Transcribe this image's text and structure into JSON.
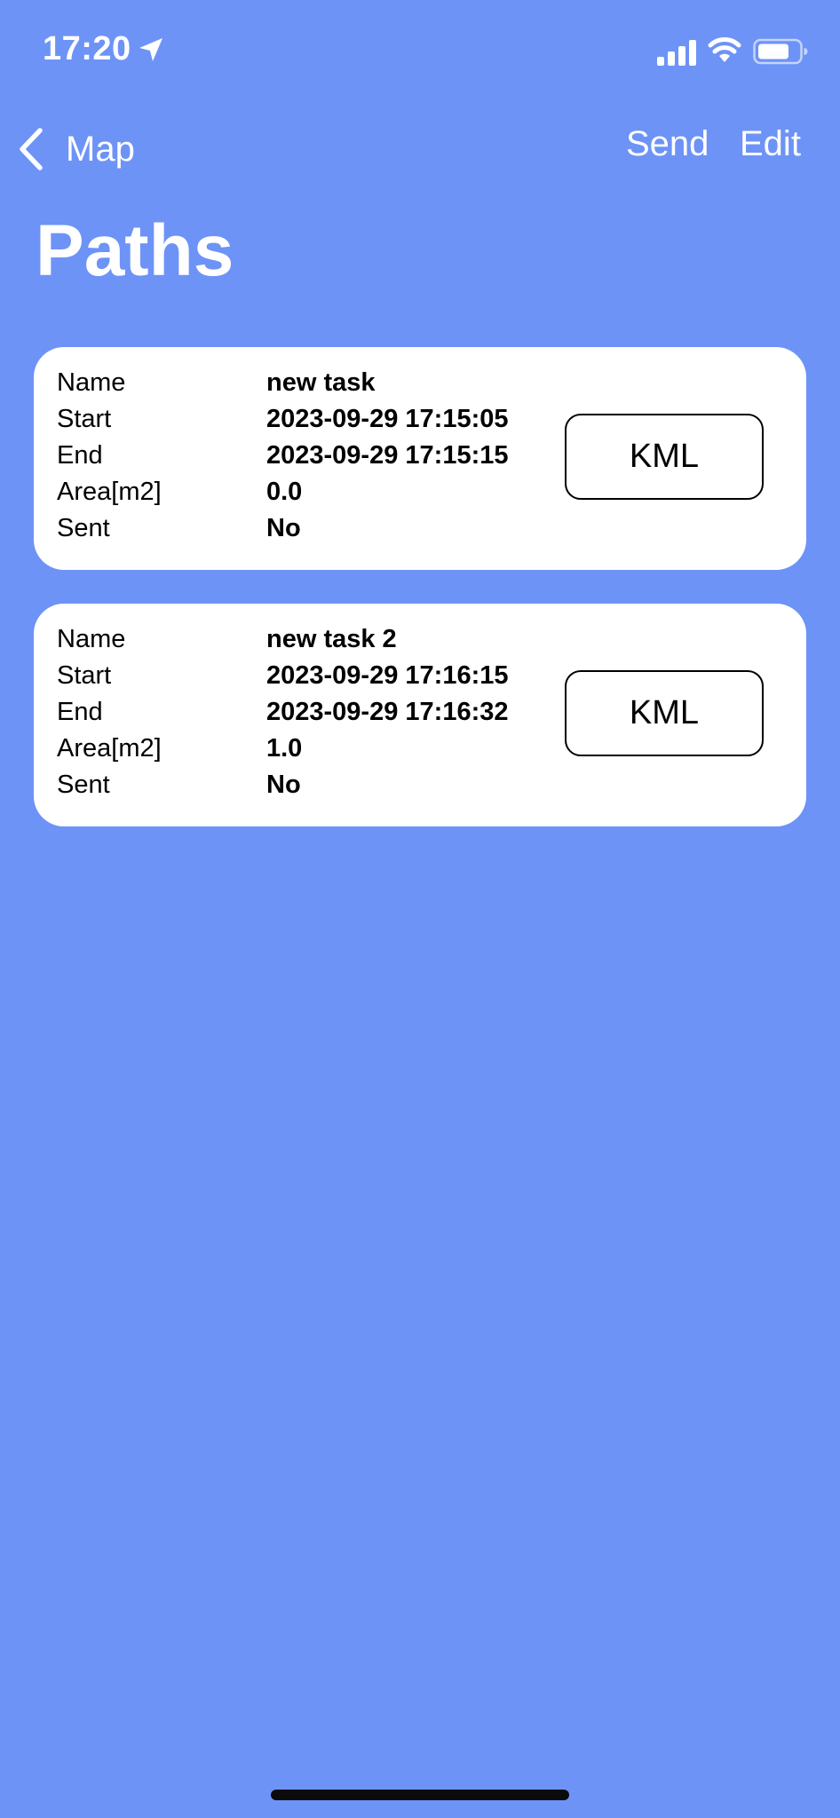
{
  "status_bar": {
    "time": "17:20"
  },
  "nav": {
    "back_label": "Map",
    "send_label": "Send",
    "edit_label": "Edit"
  },
  "page_title": "Paths",
  "paths": [
    {
      "name_label": "Name",
      "name": "new task",
      "start_label": "Start",
      "start": "2023-09-29 17:15:05",
      "end_label": "End",
      "end": "2023-09-29 17:15:15",
      "area_label": "Area[m2]",
      "area": "0.0",
      "sent_label": "Sent",
      "sent": "No",
      "button_label": "KML"
    },
    {
      "name_label": "Name",
      "name": "new task 2",
      "start_label": "Start",
      "start": "2023-09-29 17:16:15",
      "end_label": "End",
      "end": "2023-09-29 17:16:32",
      "area_label": "Area[m2]",
      "area": "1.0",
      "sent_label": "Sent",
      "sent": "No",
      "button_label": "KML"
    }
  ],
  "colors": {
    "background": "#6d93f7",
    "card": "#ffffff",
    "text_on_background": "#ffffff"
  },
  "icons": [
    "location-arrow-icon",
    "cellular-signal-icon",
    "wifi-icon",
    "battery-icon",
    "chevron-left-icon"
  ]
}
